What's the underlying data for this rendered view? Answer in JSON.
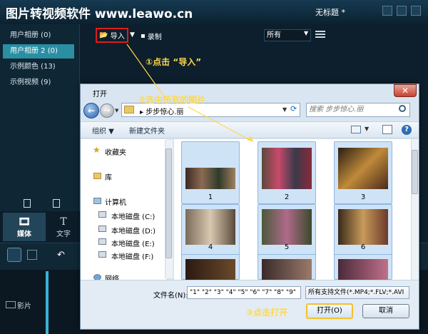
{
  "app": {
    "title": "图片转视频软件 www.leawo.cn",
    "document_title": "无标题 *"
  },
  "sidebar": {
    "items": [
      {
        "label": "用户相册 (0)"
      },
      {
        "label": "用户相册 2 (0)"
      },
      {
        "label": "示例颜色 (13)"
      },
      {
        "label": "示例视频 (9)"
      }
    ]
  },
  "toolbar": {
    "import_label": "导入",
    "record_label": "录制",
    "filter_value": "所有"
  },
  "tabs": {
    "media": "媒体",
    "text": "文字"
  },
  "timeline": {
    "track_label": "影片"
  },
  "annotations": {
    "step1": "①点击 “导入”",
    "step2": "②选中所有的图片",
    "step3": "③点击打开"
  },
  "dialog": {
    "title": "打开",
    "address": "步步惊心.丽",
    "search_placeholder": "搜索 步步惊心.丽",
    "organize": "组织",
    "new_folder": "新建文件夹",
    "nav": {
      "favorites": "收藏夹",
      "library": "库",
      "computer": "计算机",
      "drives": [
        "本地磁盘 (C:)",
        "本地磁盘 (D:)",
        "本地磁盘 (E:)",
        "本地磁盘 (F:)"
      ],
      "network": "网络"
    },
    "files": [
      {
        "name": "1"
      },
      {
        "name": "2"
      },
      {
        "name": "3"
      },
      {
        "name": "4"
      },
      {
        "name": "5"
      },
      {
        "name": "6"
      }
    ],
    "filename_label": "文件名(N):",
    "filename_value": "\"1\" \"2\" \"3\" \"4\" \"5\" \"6\" \"7\" \"8\" \"9\"",
    "filetype_value": "所有支持文件(*.MP4;*.FLV;*.AVI",
    "open_label": "打开(O)",
    "cancel_label": "取消"
  },
  "colors": {
    "accent": "#2a8fa3",
    "annotation": "#ffd84a",
    "highlight_red": "#e21a1a",
    "highlight_yellow": "#f2c12e"
  },
  "icons": {
    "close": "close-icon",
    "back": "back-arrow-icon",
    "search": "search-icon",
    "folder": "folder-icon",
    "help": "help-icon"
  }
}
